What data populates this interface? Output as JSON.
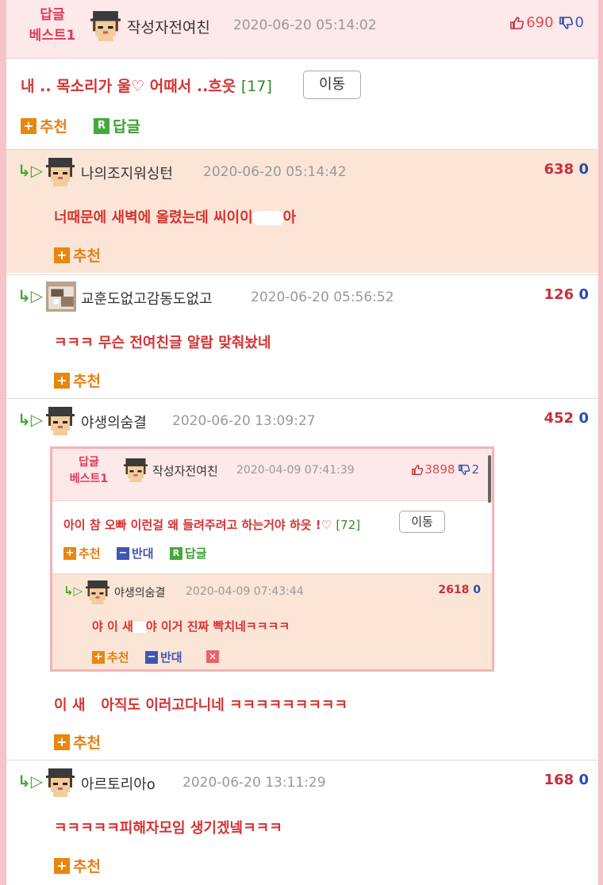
{
  "header": {
    "best_line1": "답글",
    "best_line2": "베스트1",
    "author": "작성자전여친",
    "date": "2020-06-20 05:14:02",
    "up_count": "690",
    "down_count": "0",
    "title": "내 .. 목소리가 울♡ 어때서 ..흐읏",
    "reply_count": "[17]",
    "move_label": "이동",
    "recommend_label": "추천",
    "reply_label": "답글"
  },
  "replies": [
    {
      "author": "나의조지워싱턴",
      "date": "2020-06-20 05:14:42",
      "up": "638",
      "down": "0",
      "text": "너때문에 새벽에 올렸는데 씨이이",
      "text_end": "아",
      "recommend_label": "추천"
    },
    {
      "author": "교훈도없고감동도없고",
      "date": "2020-06-20 05:56:52",
      "up": "126",
      "down": "0",
      "text": "ㅋㅋㅋ 무슨 전여친글 알람 맞춰놨네",
      "recommend_label": "추천"
    },
    {
      "author": "야생의숨결",
      "date": "2020-06-20 13:09:27",
      "up": "452",
      "down": "0",
      "text": "이 새",
      "text_end": "아직도 이러고다니네 ㅋㅋㅋㅋㅋㅋㅋㅋㅋ",
      "recommend_label": "추천"
    },
    {
      "author": "아르토리아o",
      "date": "2020-06-20 13:11:29",
      "up": "168",
      "down": "0",
      "text": "ㅋㅋㅋㅋㅋ피해자모임 생기겠넼ㅋㅋㅋ",
      "recommend_label": "추천"
    }
  ],
  "embed": {
    "best_line1": "답글",
    "best_line2": "베스트1",
    "author": "작성자전여친",
    "date": "2020-04-09 07:41:39",
    "up": "3898",
    "down": "2",
    "title": "아이 참 오빠 이런걸 왜 들려주려고 하는거야 하읏 !♡",
    "reply_count": "[72]",
    "move_label": "이동",
    "recommend_label": "추천",
    "oppose_label": "반대",
    "reply_label": "답글",
    "reply": {
      "author": "야생의숨결",
      "date": "2020-04-09 07:43:44",
      "up": "2618",
      "down": "0",
      "text": "야 이 새",
      "text_end": "야 이거 진짜 빡치네ㅋㅋㅋㅋ",
      "recommend_label": "추천",
      "oppose_label": "반대"
    }
  },
  "icons": {
    "thumb_up": "thumbs-up-icon",
    "thumb_down": "thumbs-down-icon",
    "reply_arrow": "reply-arrow-icon",
    "plus": "plus-icon",
    "r": "reply-r-icon",
    "minus": "minus-icon",
    "x": "close-icon"
  },
  "colors": {
    "accent_red": "#d63232",
    "best_pink": "#e03a57",
    "header_bg": "#fde8ea",
    "highlight_bg": "#fbe5d6",
    "up_red": "#c6303b",
    "down_blue": "#2b4ba8",
    "green": "#41a832",
    "orange": "#e8870f"
  }
}
